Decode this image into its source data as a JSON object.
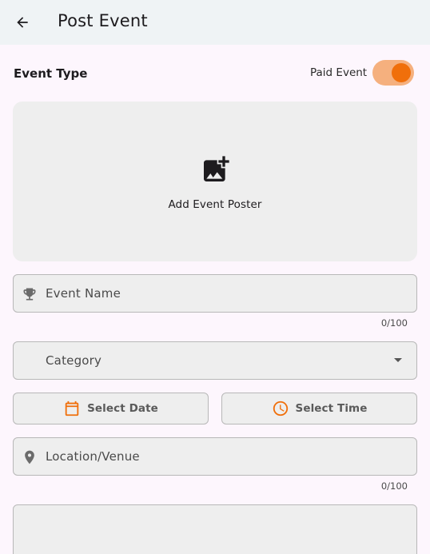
{
  "appbar": {
    "title": "Post Event"
  },
  "event_type": {
    "label": "Event Type",
    "paid_label": "Paid Event",
    "paid_enabled": true
  },
  "poster": {
    "label": "Add Event Poster"
  },
  "fields": {
    "event_name": {
      "placeholder": "Event Name",
      "counter": "0/100"
    },
    "category": {
      "placeholder": "Category"
    },
    "location": {
      "placeholder": "Location/Venue",
      "counter": "0/100"
    }
  },
  "buttons": {
    "select_date": "Select Date",
    "select_time": "Select Time"
  },
  "colors": {
    "accent": "#f06f0b",
    "toggle_track": "#f5b07e",
    "field_bg": "#eeeeee",
    "appbar_bg": "#eff3f5"
  }
}
